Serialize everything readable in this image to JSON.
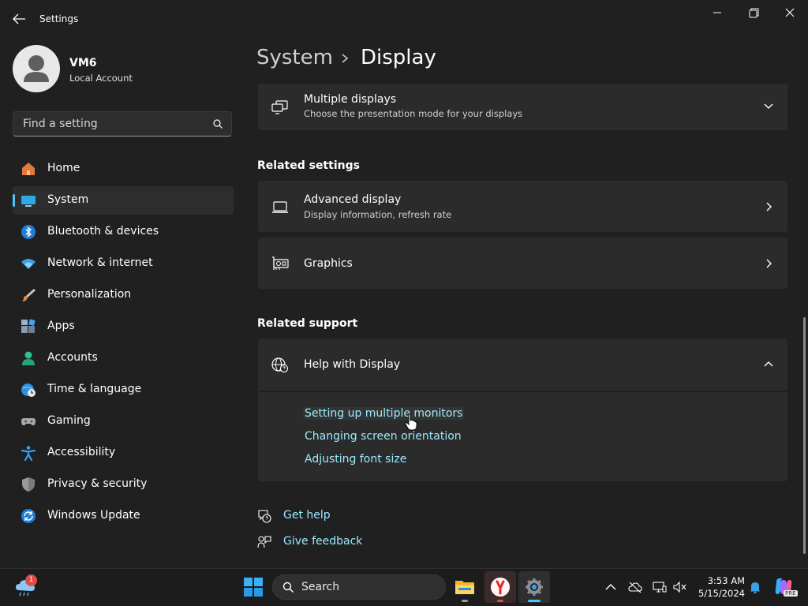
{
  "window": {
    "title": "Settings",
    "controls": [
      "minimize-icon",
      "restore-icon",
      "close-icon"
    ]
  },
  "profile": {
    "name": "VM6",
    "account_type": "Local Account"
  },
  "search": {
    "placeholder": "Find a setting"
  },
  "sidebar": {
    "selected": "System",
    "items": [
      {
        "label": "Home",
        "icon": "home-icon"
      },
      {
        "label": "System",
        "icon": "system-icon"
      },
      {
        "label": "Bluetooth & devices",
        "icon": "bluetooth-icon"
      },
      {
        "label": "Network & internet",
        "icon": "wifi-icon"
      },
      {
        "label": "Personalization",
        "icon": "brush-icon"
      },
      {
        "label": "Apps",
        "icon": "apps-icon"
      },
      {
        "label": "Accounts",
        "icon": "accounts-icon"
      },
      {
        "label": "Time & language",
        "icon": "clock-globe-icon"
      },
      {
        "label": "Gaming",
        "icon": "gamepad-icon"
      },
      {
        "label": "Accessibility",
        "icon": "accessibility-icon"
      },
      {
        "label": "Privacy & security",
        "icon": "shield-icon"
      },
      {
        "label": "Windows Update",
        "icon": "update-icon"
      }
    ]
  },
  "header": {
    "parent": "System",
    "current": "Display"
  },
  "main": {
    "multiple_displays": {
      "title": "Multiple displays",
      "subtitle": "Choose the presentation mode for your displays"
    },
    "related_settings": {
      "label": "Related settings",
      "advanced_display": {
        "title": "Advanced display",
        "subtitle": "Display information, refresh rate"
      },
      "graphics": {
        "title": "Graphics"
      }
    },
    "related_support": {
      "label": "Related support",
      "help_title": "Help with Display",
      "links": [
        "Setting up multiple monitors",
        "Changing screen orientation",
        "Adjusting font size"
      ]
    },
    "get_help": "Get help",
    "give_feedback": "Give feedback"
  },
  "taskbar": {
    "weather_badge": "1",
    "search_label": "Search",
    "apps": [
      "file-explorer-icon",
      "yandex-browser-icon",
      "settings-gear-icon"
    ],
    "clock": {
      "time": "3:53 AM",
      "date": "5/15/2024"
    },
    "copilot_badge": "PRE"
  },
  "colors": {
    "background": "#202020",
    "card": "#2b2b2b",
    "accent": "#4cc2ff",
    "link": "#99ebff"
  }
}
